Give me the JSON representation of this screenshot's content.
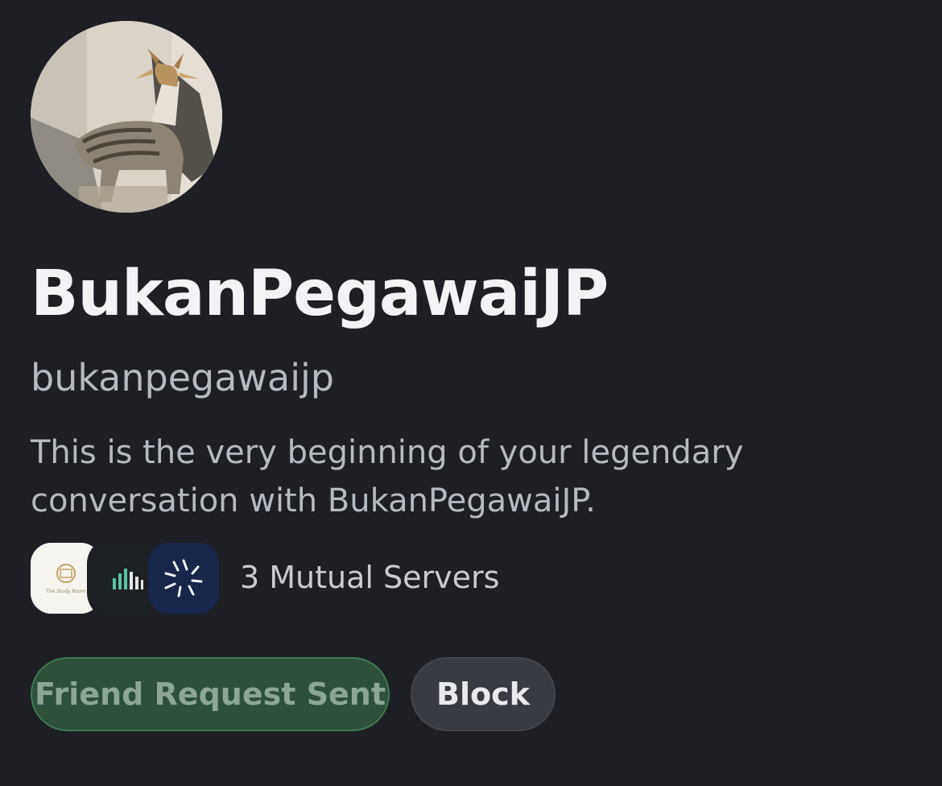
{
  "profile": {
    "display_name": "BukanPegawaiJP",
    "username": "bukanpegawaijp",
    "intro": "This is the very beginning of your legendary conversation with BukanPegawaiJP.",
    "avatar_icon": "cat-photo-avatar"
  },
  "mutual": {
    "label": "3 Mutual Servers",
    "servers": [
      {
        "icon": "study-room-server-icon",
        "text": "The Study Room"
      },
      {
        "icon": "bars-server-icon"
      },
      {
        "icon": "burst-server-icon"
      }
    ]
  },
  "actions": {
    "friend_label": "Friend Request Sent",
    "block_label": "Block"
  },
  "colors": {
    "background": "#1e1f24",
    "friend_button": "#2e4f3a",
    "block_button": "#393b42"
  }
}
